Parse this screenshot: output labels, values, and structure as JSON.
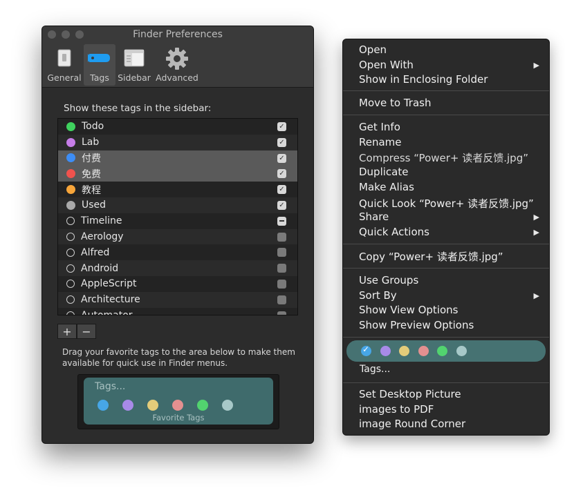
{
  "window": {
    "title": "Finder Preferences",
    "toolbar": [
      {
        "label": "General",
        "icon": "switch-icon"
      },
      {
        "label": "Tags",
        "icon": "tag-icon"
      },
      {
        "label": "Sidebar",
        "icon": "sidebar-icon"
      },
      {
        "label": "Advanced",
        "icon": "gear-icon"
      }
    ]
  },
  "tags_section": {
    "label": "Show these tags in the sidebar:",
    "rows": [
      {
        "name": "Todo",
        "color": "#3fd15e",
        "checked": "on"
      },
      {
        "name": "Lab",
        "color": "#c67de8",
        "checked": "on"
      },
      {
        "name": "付费",
        "color": "#3d8df5",
        "checked": "on",
        "selected": true
      },
      {
        "name": "免费",
        "color": "#f0524d",
        "checked": "on",
        "selected": true
      },
      {
        "name": "教程",
        "color": "#f7a53a",
        "checked": "on"
      },
      {
        "name": "Used",
        "color": "#a9a9a9",
        "checked": "on"
      },
      {
        "name": "Timeline",
        "color": null,
        "checked": "mixed"
      },
      {
        "name": "Aerology",
        "color": null,
        "checked": "off"
      },
      {
        "name": "Alfred",
        "color": null,
        "checked": "off"
      },
      {
        "name": "Android",
        "color": null,
        "checked": "off"
      },
      {
        "name": "AppleScript",
        "color": null,
        "checked": "off"
      },
      {
        "name": "Architecture",
        "color": null,
        "checked": "off"
      },
      {
        "name": "Automator",
        "color": null,
        "checked": "off"
      }
    ],
    "add_label": "+",
    "remove_label": "−"
  },
  "favorites": {
    "help_text": "Drag your favorite tags to the area below to make them available for quick use in Finder menus.",
    "placeholder": "Tags...",
    "caption": "Favorite Tags",
    "colors": [
      "#47a6e6",
      "#a88ae8",
      "#e3cc7a",
      "#e39090",
      "#52d36f",
      "#a7c8c8"
    ]
  },
  "context_menu": {
    "group1": [
      "Open",
      "Open With",
      "Show in Enclosing Folder"
    ],
    "group2": [
      "Move to Trash"
    ],
    "group3": [
      "Get Info",
      "Rename",
      "Compress “Power+ 读者反馈.jpg”",
      "Duplicate",
      "Make Alias",
      "Quick Look “Power+ 读者反馈.jpg”",
      "Share",
      "Quick Actions"
    ],
    "group4": [
      "Copy “Power+ 读者反馈.jpg”"
    ],
    "group5": [
      "Use Groups",
      "Sort By",
      "Show View Options",
      "Show Preview Options"
    ],
    "tag_colors": [
      "#47a6e6",
      "#a88ae8",
      "#e3cc7a",
      "#e39090",
      "#52d36f",
      "#a7c8c8"
    ],
    "tags_label": "Tags...",
    "group6": [
      "Set Desktop Picture",
      "images to PDF",
      "image Round Corner"
    ],
    "submenu_arrow": "▶"
  }
}
